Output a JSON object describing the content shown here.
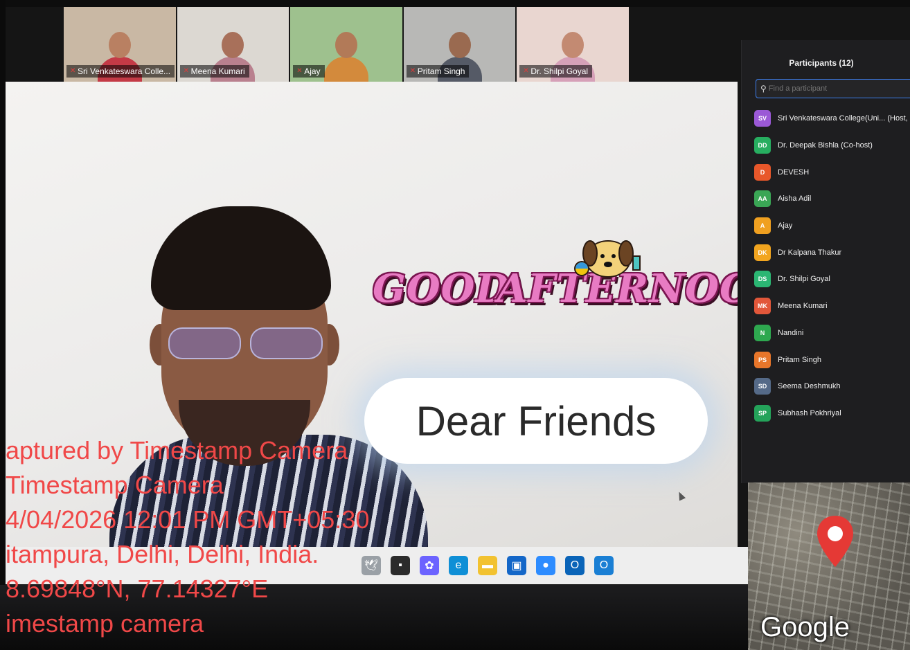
{
  "gallery": {
    "tiles": [
      {
        "name": "Sri Venkateswara Colle...",
        "bg": "#c9b8a4",
        "skin": "#b98062",
        "cloth": "#c43a46"
      },
      {
        "name": "Meena Kumari",
        "bg": "#dcd8d2",
        "skin": "#a8705a",
        "cloth": "#b9808e"
      },
      {
        "name": "Ajay",
        "bg": "#9ec18e",
        "skin": "#b27a58",
        "cloth": "#d38a3c"
      },
      {
        "name": "Pritam Singh",
        "bg": "#b8b8b6",
        "skin": "#9a6a50",
        "cloth": "#555a66"
      },
      {
        "name": "Dr. Shilpi Goyal",
        "bg": "#e9d6d0",
        "skin": "#c38a72",
        "cloth": "#d6a0b8"
      }
    ]
  },
  "main": {
    "greeting_word1": "GOOD",
    "greeting_word2": "AFTERNOON",
    "speech_text": "Dear Friends"
  },
  "participants": {
    "title": "Participants (12)",
    "search_placeholder": "Find a participant",
    "items": [
      {
        "initials": "SV",
        "name": "Sri Venkateswara College(Uni... (Host, m",
        "color": "#9b59d6"
      },
      {
        "initials": "DD",
        "name": "Dr. Deepak Bishla (Co-host)",
        "color": "#27ae60"
      },
      {
        "initials": "D",
        "name": "DEVESH",
        "color": "#e8572a"
      },
      {
        "initials": "AA",
        "name": "Aisha Adil",
        "color": "#3aa655"
      },
      {
        "initials": "A",
        "name": "Ajay",
        "color": "#f0a020"
      },
      {
        "initials": "DK",
        "name": "Dr Kalpana Thakur",
        "color": "#f2a51f"
      },
      {
        "initials": "DS",
        "name": "Dr. Shilpi Goyal",
        "color": "#2bb673"
      },
      {
        "initials": "MK",
        "name": "Meena Kumari",
        "color": "#e2573a"
      },
      {
        "initials": "N",
        "name": "Nandini",
        "color": "#2ea84f"
      },
      {
        "initials": "PS",
        "name": "Pritam Singh",
        "color": "#e8762a"
      },
      {
        "initials": "SD",
        "name": "Seema Deshmukh",
        "color": "#556a88"
      },
      {
        "initials": "SP",
        "name": "Subhash Pokhriyal",
        "color": "#24a35a"
      }
    ]
  },
  "taskbar": {
    "icons": [
      {
        "name": "bird-app-icon",
        "glyph": "🕊",
        "color": "#9aa0a6"
      },
      {
        "name": "terminal-icon",
        "glyph": "▪",
        "color": "#2b2b2b"
      },
      {
        "name": "copilot-icon",
        "glyph": "✿",
        "color": "#6c63ff"
      },
      {
        "name": "edge-icon",
        "glyph": "e",
        "color": "#0f8fd6"
      },
      {
        "name": "folder-icon",
        "glyph": "▬",
        "color": "#f2c230"
      },
      {
        "name": "store-icon",
        "glyph": "▣",
        "color": "#1467c8"
      },
      {
        "name": "zoom-icon",
        "glyph": "●",
        "color": "#2d8cff"
      },
      {
        "name": "outlook-icon",
        "glyph": "O",
        "color": "#0a64b8"
      },
      {
        "name": "outlook-new-icon",
        "glyph": "O",
        "color": "#1a7fd4"
      }
    ]
  },
  "map": {
    "logo": "Google"
  },
  "timestamp": {
    "line1": "aptured by Timestamp Camera",
    "line2": "Timestamp Camera",
    "line3": "4/04/2026 12:01 PM GMT+05:30",
    "line4": "itampura, Delhi, Delhi, India.",
    "line5": "8.69848°N, 77.14327°E",
    "line6": "imestamp camera"
  },
  "colors": {
    "accent": "#3d7ff0",
    "overlay_text": "#f04848",
    "mic_muted": "#e03a3a"
  }
}
